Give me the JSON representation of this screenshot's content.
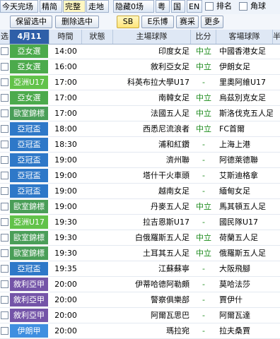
{
  "toolbar": {
    "items": [
      "今天完场",
      "精简",
      "完整",
      "走地",
      "隐藏0场",
      "粤",
      "国",
      "EN",
      "排名",
      "角球"
    ]
  },
  "actions": {
    "keep_selected": "保留选中",
    "delete_selected": "删除选中",
    "sb": "SB",
    "e_lebo": "E乐博",
    "saicai": "赛采",
    "more": "更多"
  },
  "header": {
    "col_select": "选",
    "date": "4月11",
    "time": "時間",
    "status": "狀態",
    "home": "主場球隊",
    "score": "比分",
    "away": "客場球隊",
    "extra": "半"
  },
  "colors": {
    "afc": "#2e78c8",
    "asia_u17": "#5fbf3f",
    "eu_nations": "#4aa05a",
    "syria": "#7454a8",
    "iran": "#3f8fe0",
    "sel_btn": "#ffe57a"
  },
  "matches": [
    {
      "league": "亞女選",
      "time": "14:00",
      "home": "印度女足",
      "score": "中立",
      "away": "中國香港女足",
      "color": "#4caa4c"
    },
    {
      "league": "亞女選",
      "time": "16:00",
      "home": "敘利亞女足",
      "score": "中立",
      "away": "伊朗女足",
      "color": "#4caa4c"
    },
    {
      "league": "亞洲U17",
      "time": "17:00",
      "home": "科英布拉大學U17",
      "score": "-",
      "away": "里奧阿維U17",
      "color": "#62c24a"
    },
    {
      "league": "亞女選",
      "time": "17:00",
      "home": "南韓女足",
      "score": "中立",
      "away": "烏茲別克女足",
      "color": "#4caa4c"
    },
    {
      "league": "歐室錦標",
      "time": "17:00",
      "home": "法國五人足",
      "score": "中立",
      "away": "斯洛伐克五人足",
      "color": "#4a9e58"
    },
    {
      "league": "亞冠盃",
      "time": "18:00",
      "home": "西悉尼流浪者",
      "score": "中立",
      "away": "FC首爾",
      "color": "#2e78c8"
    },
    {
      "league": "亞冠盃",
      "time": "18:30",
      "home": "浦和紅鑽",
      "score": "-",
      "away": "上海上港",
      "color": "#2e78c8"
    },
    {
      "league": "亞冠盃",
      "time": "19:00",
      "home": "濟州聯",
      "score": "-",
      "away": "阿德萊德聯",
      "color": "#2e78c8"
    },
    {
      "league": "亞冠盃",
      "time": "19:00",
      "home": "塔什干火車頭",
      "score": "-",
      "away": "艾斯迪格拿",
      "color": "#2e78c8"
    },
    {
      "league": "亞冠盃",
      "time": "19:00",
      "home": "越南女足",
      "score": "-",
      "away": "緬甸女足",
      "color": "#2e78c8"
    },
    {
      "league": "歐室錦標",
      "time": "19:00",
      "home": "丹麥五人足",
      "score": "中立",
      "away": "馬其頓五人足",
      "color": "#4a9e58"
    },
    {
      "league": "亞洲U17",
      "time": "19:30",
      "home": "拉吉恩斯U17",
      "score": "-",
      "away": "國民隊U17",
      "color": "#62c24a"
    },
    {
      "league": "歐室錦標",
      "time": "19:30",
      "home": "白俄羅斯五人足",
      "score": "中立",
      "away": "荷蘭五人足",
      "color": "#4a9e58"
    },
    {
      "league": "歐室錦標",
      "time": "19:30",
      "home": "土耳其五人足",
      "score": "中立",
      "away": "俄羅斯五人足",
      "color": "#4a9e58"
    },
    {
      "league": "亞冠盃",
      "time": "19:35",
      "home": "江蘇蘇寧",
      "score": "-",
      "away": "大阪飛腳",
      "color": "#2e78c8"
    },
    {
      "league": "敘利亞甲",
      "time": "20:00",
      "home": "伊蒂哈德阿勒頗",
      "score": "-",
      "away": "莫哈法莎",
      "color": "#7454a8"
    },
    {
      "league": "敘利亞甲",
      "time": "20:00",
      "home": "警察俱樂部",
      "score": "-",
      "away": "賈伊什",
      "color": "#7454a8"
    },
    {
      "league": "敘利亞甲",
      "time": "20:00",
      "home": "阿爾瓦思巴",
      "score": "-",
      "away": "阿爾瓦達",
      "color": "#7454a8"
    },
    {
      "league": "伊朗甲",
      "time": "20:00",
      "home": "瑪拉宛",
      "score": "-",
      "away": "拉夫桑賈",
      "color": "#3f8fe0"
    }
  ]
}
